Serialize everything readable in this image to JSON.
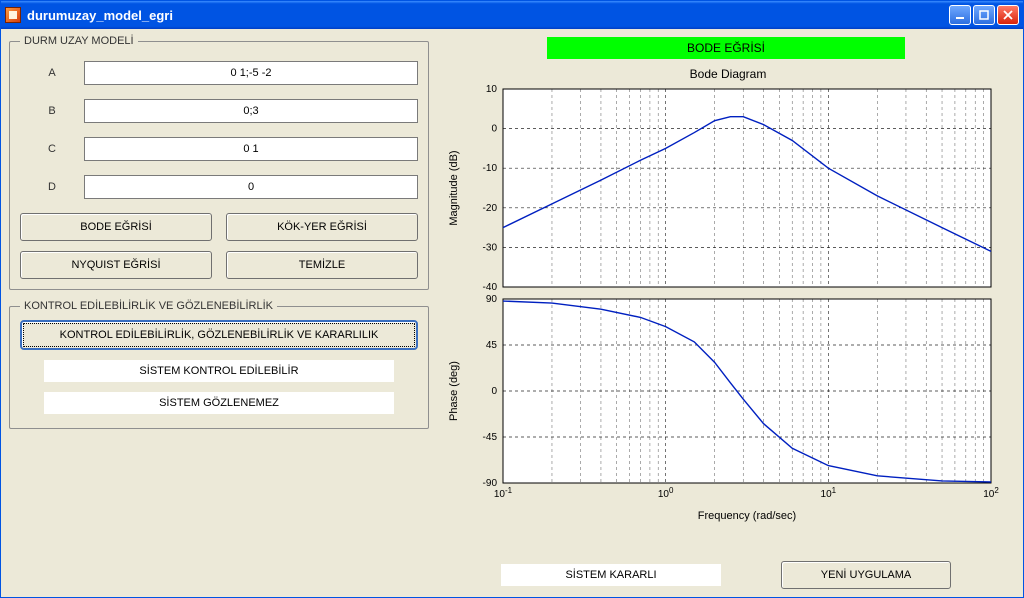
{
  "window": {
    "title": "durumuzay_model_egri"
  },
  "model_panel": {
    "legend": "DURM UZAY MODELİ",
    "rows": {
      "A": {
        "label": "A",
        "value": "0 1;-5 -2"
      },
      "B": {
        "label": "B",
        "value": "0;3"
      },
      "C": {
        "label": "C",
        "value": "0 1"
      },
      "D": {
        "label": "D",
        "value": "0"
      }
    },
    "buttons": {
      "bode": "BODE EĞRİSİ",
      "rootlocus": "KÖK-YER EĞRİSİ",
      "nyquist": "NYQUIST EĞRİSİ",
      "clear": "TEMİZLE"
    }
  },
  "control_panel": {
    "legend": "KONTROL EDİLEBİLİRLİK VE GÖZLENEBİLİRLİK",
    "analyze_button": "KONTROL EDİLEBİLİRLİK, GÖZLENEBİLİRLİK VE KARARLILIK",
    "controllable": "SİSTEM KONTROL EDİLEBİLİR",
    "observable": "SİSTEM GÖZLENEMEZ"
  },
  "right": {
    "header": "BODE EĞRİSİ",
    "chart_title": "Bode Diagram",
    "xlabel": "Frequency  (rad/sec)",
    "ylabel_mag": "Magnitude (dB)",
    "ylabel_phase": "Phase (deg)",
    "stable_text": "SİSTEM KARARLI",
    "new_app_button": "YENİ UYGULAMA"
  },
  "chart_data": [
    {
      "type": "line",
      "title": "Bode Diagram",
      "xlabel": "Frequency (rad/sec)",
      "ylabel": "Magnitude (dB)",
      "x_scale": "log",
      "xlim": [
        0.1,
        100
      ],
      "ylim": [
        -40,
        10
      ],
      "yticks": [
        -40,
        -30,
        -20,
        -10,
        0,
        10
      ],
      "series": [
        {
          "name": "Magnitude",
          "x": [
            0.1,
            0.2,
            0.4,
            0.7,
            1.0,
            1.5,
            2.0,
            2.5,
            3.0,
            4.0,
            6.0,
            10,
            20,
            50,
            100
          ],
          "y": [
            -25,
            -19,
            -13,
            -8,
            -5,
            -1,
            2,
            3,
            3,
            1,
            -3,
            -10,
            -17,
            -25,
            -31
          ]
        }
      ]
    },
    {
      "type": "line",
      "xlabel": "Frequency (rad/sec)",
      "ylabel": "Phase (deg)",
      "x_scale": "log",
      "xlim": [
        0.1,
        100
      ],
      "ylim": [
        -90,
        90
      ],
      "yticks": [
        -90,
        -45,
        0,
        45,
        90
      ],
      "series": [
        {
          "name": "Phase",
          "x": [
            0.1,
            0.2,
            0.4,
            0.7,
            1.0,
            1.5,
            2.0,
            2.5,
            3.0,
            4.0,
            6.0,
            10,
            20,
            50,
            100
          ],
          "y": [
            88,
            86,
            80,
            72,
            63,
            48,
            28,
            8,
            -8,
            -32,
            -56,
            -73,
            -83,
            -88,
            -89
          ]
        }
      ]
    }
  ]
}
